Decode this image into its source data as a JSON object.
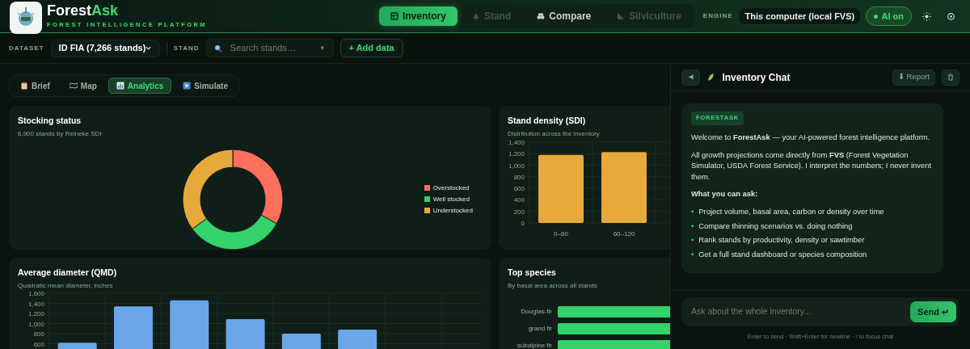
{
  "header": {
    "brand_start": "Forest",
    "brand_end": "Ask",
    "tagline": "FOREST INTELLIGENCE PLATFORM",
    "nav": [
      {
        "label": "Inventory",
        "selected": true,
        "disabled": false
      },
      {
        "label": "Stand",
        "selected": false,
        "disabled": true
      },
      {
        "label": "Compare",
        "selected": false,
        "disabled": false
      },
      {
        "label": "Silviculture",
        "selected": false,
        "disabled": true
      }
    ],
    "engine": {
      "label": "ENGINE",
      "value": "This computer (local FVS)"
    },
    "ai_toggle": {
      "label": "AI on",
      "on": true
    }
  },
  "toolbar": {
    "dataset_label": "DATASET",
    "dataset_value": "ID FIA (7,266 stands)",
    "stand_label": "STAND",
    "search": {
      "placeholder": "Search stands…",
      "caret": "▼"
    },
    "add_button": "+ Add data"
  },
  "view_tabs": [
    {
      "label": "Brief",
      "selected": false
    },
    {
      "label": "Map",
      "selected": false
    },
    {
      "label": "Analytics",
      "selected": true
    },
    {
      "label": "Simulate",
      "selected": false
    }
  ],
  "cards": [
    {
      "title": "Stocking status",
      "subtitle": "6,900 stands by Reineke SDI",
      "chart_data": {
        "type": "donut",
        "categories": [
          "Overstocked",
          "Well stocked",
          "Understocked"
        ],
        "values": [
          33,
          32,
          35
        ],
        "colors": [
          "#ff6f5e",
          "#34d26b",
          "#e8a93c"
        ]
      }
    },
    {
      "title": "Stand density (SDI)",
      "subtitle": "Distribution across the inventory",
      "chart_data": {
        "type": "bar",
        "categories": [
          "0–60",
          "60–120"
        ],
        "series": [
          {
            "color": "#e8a93c",
            "values": [
              1180,
              1230
            ]
          }
        ],
        "ylim": [
          0,
          1400
        ],
        "yticks": [
          0,
          200,
          400,
          600,
          800,
          {
            "value": 1000,
            "label": "1,000"
          },
          {
            "value": 1200,
            "label": "1,200"
          },
          {
            "value": 1400,
            "label": "1,400"
          }
        ],
        "grid": true
      }
    },
    {
      "title": "Average diameter (QMD)",
      "subtitle": "Quadratic mean diameter, inches",
      "chart_data": {
        "type": "bar",
        "series": [
          {
            "color": "#6aa6e8",
            "values": [
              620,
              1340,
              1460,
              1090,
              800,
              880,
              null,
              null
            ]
          }
        ],
        "ylim": [
          0,
          1600
        ],
        "yticks": [
          600,
          800,
          {
            "value": 1000,
            "label": "1,000"
          },
          {
            "value": 1200,
            "label": "1,200"
          },
          {
            "value": 1400,
            "label": "1,400"
          },
          {
            "value": 1600,
            "label": "1,600"
          }
        ],
        "grid": true
      }
    },
    {
      "kind": "hbar",
      "title": "Top species",
      "subtitle": "By basal area across all stands",
      "labels": [
        "Douglas-fir",
        "grand fir",
        "subalpine fir"
      ]
    }
  ],
  "chat": {
    "title": "Inventory Chat",
    "collapse": "◄",
    "report": "⬇ Report",
    "message": {
      "badge": "FORESTASK",
      "paragraphs": [
        "Welcome to **ForestAsk** — your AI-powered forest intelligence platform.",
        "All growth projections come directly from **FVS** (Forest Vegetation Simulator, USDA Forest Service). I interpret the numbers; I never invent them."
      ],
      "heading": "What you can ask:",
      "items": [
        {
          "bullet": "•",
          "text": "Project volume, basal area, carbon or density over time"
        },
        {
          "bullet": "•",
          "text": "Compare thinning scenarios vs. doing nothing"
        },
        {
          "bullet": "•",
          "text": "Rank stands by productivity, density or sawtimber"
        },
        {
          "bullet": "•",
          "text": "Get a full stand dashboard or species composition"
        }
      ]
    },
    "input": {
      "placeholder": "Ask about the whole inventory..."
    },
    "send": "Send ↵",
    "hint": "Enter to send · Shift+Enter for newline · / to focus chat"
  }
}
